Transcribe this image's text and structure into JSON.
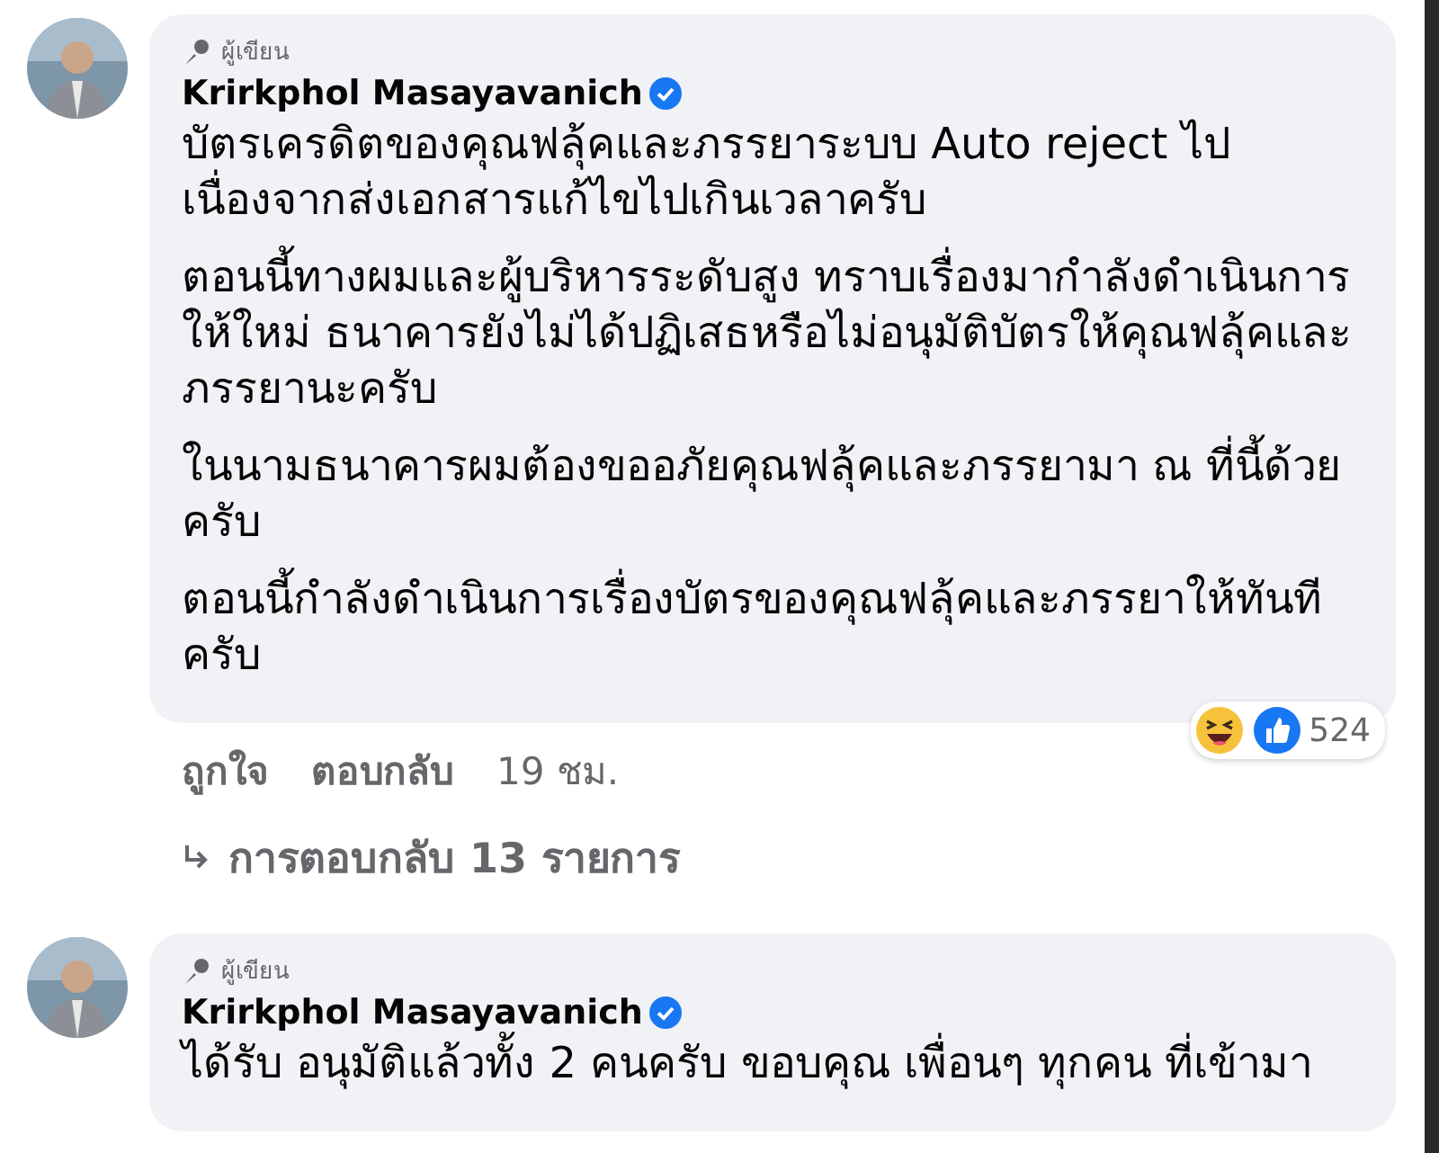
{
  "comments": [
    {
      "badge": "ผู้เขียน",
      "author": "Krirkphol Masayavanich",
      "verified": true,
      "paragraphs": [
        "บัตรเครดิตของคุณฟลุ้คและภรรยาระบบ Auto reject ไป เนื่องจากส่งเอกสารแก้ไขไปเกินเวลาครับ",
        "ตอนนี้ทางผมและผู้บริหารระดับสูง ทราบเรื่องมากำลังดำเนินการให้ใหม่ ธนาคารยังไม่ได้ปฏิเสธหรือไม่อนุมัติบัตรให้คุณฟลุ้คและภรรยานะครับ",
        "ในนามธนาคารผมต้องขออภัยคุณฟลุ้คและภรรยามา ณ ที่นี้ด้วยครับ",
        "ตอนนี้กำลังดำเนินการเรื่องบัตรของคุณฟลุ้คและภรรยาให้ทันทีครับ"
      ],
      "reaction_count": "524",
      "actions": [
        "ถูกใจ",
        "ตอบกลับ"
      ],
      "time": "19 ชม.",
      "replies": "การตอบกลับ 13 รายการ"
    },
    {
      "badge": "ผู้เขียน",
      "author": "Krirkphol Masayavanich",
      "verified": true,
      "paragraphs": [
        "ได้รับ อนุมัติแล้วทั้ง 2 คนครับ ขอบคุณ เพื่อนๆ ทุกคน ที่เข้ามา"
      ]
    }
  ]
}
